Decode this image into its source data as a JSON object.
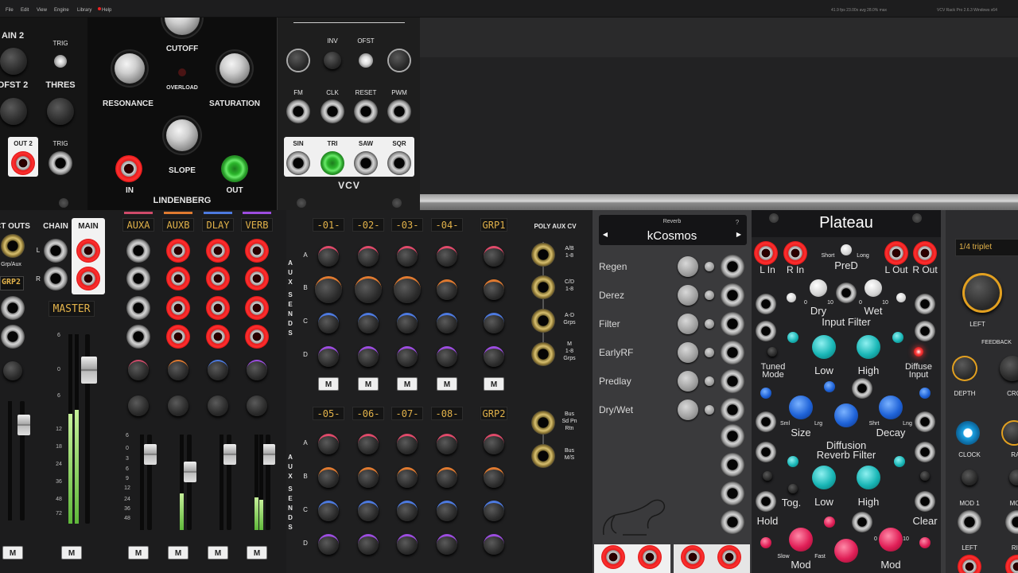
{
  "menu": {
    "items": [
      "File",
      "Edit",
      "View",
      "Engine",
      "Library",
      "Help"
    ],
    "perf": "41.9 fps  23.00x avg  28.0% max",
    "version": "VCV Rack Pro 2.6.3 Windows x64"
  },
  "mod_a": {
    "gain2": "AIN 2",
    "trig": "TRIG",
    "ofst2": "OFST 2",
    "thres": "THRES",
    "out2": "OUT 2",
    "trig2": "TRIG"
  },
  "lindenberg": {
    "cutoff": "CUTOFF",
    "resonance": "RESONANCE",
    "overload": "OVERLOAD",
    "saturation": "SATURATION",
    "slope": "SLOPE",
    "in": "IN",
    "name": "LINDENBERG",
    "out": "OUT"
  },
  "vco": {
    "inv": "INV",
    "ofst": "OFST",
    "fm": "FM",
    "clk": "CLK",
    "reset": "RESET",
    "pwm": "PWM",
    "sin": "SIN",
    "tri": "TRI",
    "saw": "SAW",
    "sqr": "SQR",
    "logo": "VCV"
  },
  "mixer": {
    "ct_outs": "CT OUTS",
    "grp_aux": "Grp/Aux",
    "grp2": "GRP2",
    "chain": "CHAIN",
    "main": "MAIN",
    "l": "L",
    "r": "R",
    "master": "MASTER",
    "aux_names": [
      "AUXA",
      "AUXB",
      "DLAY",
      "VERB"
    ],
    "mute": "M",
    "scale_master": [
      "6",
      "0",
      "6",
      "12",
      "18",
      "24",
      "36",
      "48",
      "72"
    ],
    "scale_aux": [
      "6",
      "0",
      "3",
      "6",
      "9",
      "12",
      "24",
      "36",
      "48"
    ]
  },
  "aux_sends": {
    "channels_top": [
      "-01-",
      "-02-",
      "-03-",
      "-04-"
    ],
    "grp_top": "GRP1",
    "channels_bottom": [
      "-05-",
      "-06-",
      "-07-",
      "-08-"
    ],
    "grp_bottom": "GRP2",
    "rows": [
      "A",
      "B",
      "C",
      "D"
    ],
    "vertical_label": [
      "A",
      "U",
      "X",
      "S",
      "E",
      "N",
      "D",
      "S"
    ],
    "mute": "M"
  },
  "poly_aux": {
    "title": "POLY AUX CV",
    "labels": [
      "A/B\n1-8",
      "C/D\n1-8",
      "A-D\nGrps",
      "M\n1-8\nGrps",
      "Bus\nSd Pn\nRtn",
      "Bus\nM/S"
    ]
  },
  "kcosmos": {
    "type": "Reverb",
    "name": "kCosmos",
    "help": "?",
    "prev": "◀",
    "next": "▶",
    "params": [
      "Regen",
      "Derez",
      "Filter",
      "EarlyRF",
      "Predlay",
      "Dry/Wet"
    ]
  },
  "plateau": {
    "title": "Plateau",
    "l_in": "L In",
    "r_in": "R In",
    "short": "Short",
    "long": "Long",
    "pred": "PreD",
    "l_out": "L Out",
    "r_out": "R Out",
    "dry": "Dry",
    "wet": "Wet",
    "zero": "0",
    "ten": "10",
    "input_filter": "Input Filter",
    "tuned_mode": "Tuned\nMode",
    "low": "Low",
    "high": "High",
    "diffuse_input": "Diffuse\nInput",
    "sml": "Sml",
    "lrg": "Lrg",
    "size": "Size",
    "shrt": "Shrt",
    "lng": "Lng",
    "decay": "Decay",
    "diffusion": "Diffusion",
    "reverb_filter": "Reverb Filter",
    "tog": "Tog.",
    "hold": "Hold",
    "clear": "Clear",
    "slow": "Slow",
    "fast": "Fast",
    "mod": "Mod"
  },
  "delay": {
    "time": "1/4 triplet",
    "left": "LEFT",
    "feedback": "FEEDBACK",
    "depth": "DEPTH",
    "cro": "CRO",
    "clock": "CLOCK",
    "rat": "RAT",
    "mod1": "MOD 1",
    "mod": "MOD",
    "left2": "LEFT",
    "rig": "RIG"
  }
}
